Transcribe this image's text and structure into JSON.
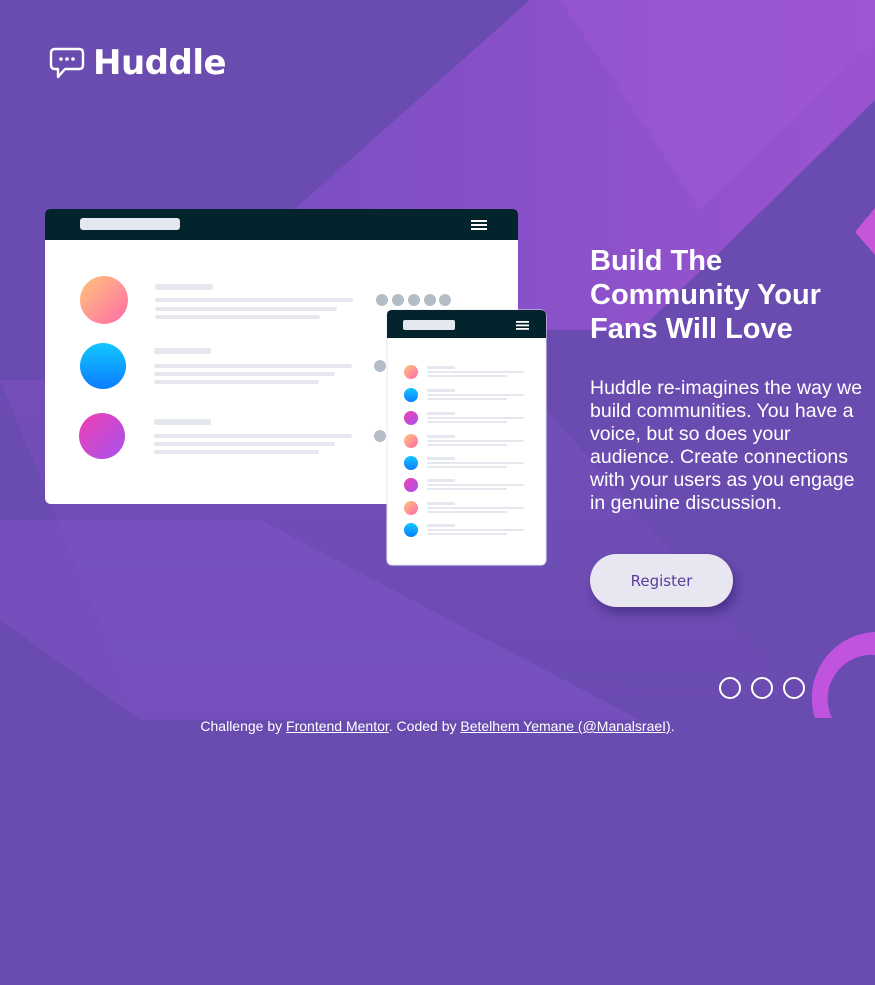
{
  "brand": {
    "name": "Huddle",
    "icon": "chat-bubble-icon"
  },
  "hero": {
    "title": "Build The Community Your Fans Will Love",
    "description": "Huddle re-imagines the way we build communities. You have a voice, but so does your audience. Create connections with your users as you engage in genuine discussion.",
    "cta_label": "Register"
  },
  "socials": [
    {
      "icon": "social-icon-facebook"
    },
    {
      "icon": "social-icon-twitter"
    },
    {
      "icon": "social-icon-instagram"
    }
  ],
  "attribution": {
    "prefix": "Challenge by ",
    "link1": "Frontend Mentor",
    "middle": ". Coded by ",
    "link2": "Betelhem Yemane (@ManalsraeI)",
    "suffix": "."
  },
  "colors": {
    "background": "#6a4bb0",
    "accent_violet": "#a052d6",
    "cta_text": "#5a3e9a",
    "cta_bg": "#e8e6f0",
    "mockup_header": "#03242c"
  }
}
